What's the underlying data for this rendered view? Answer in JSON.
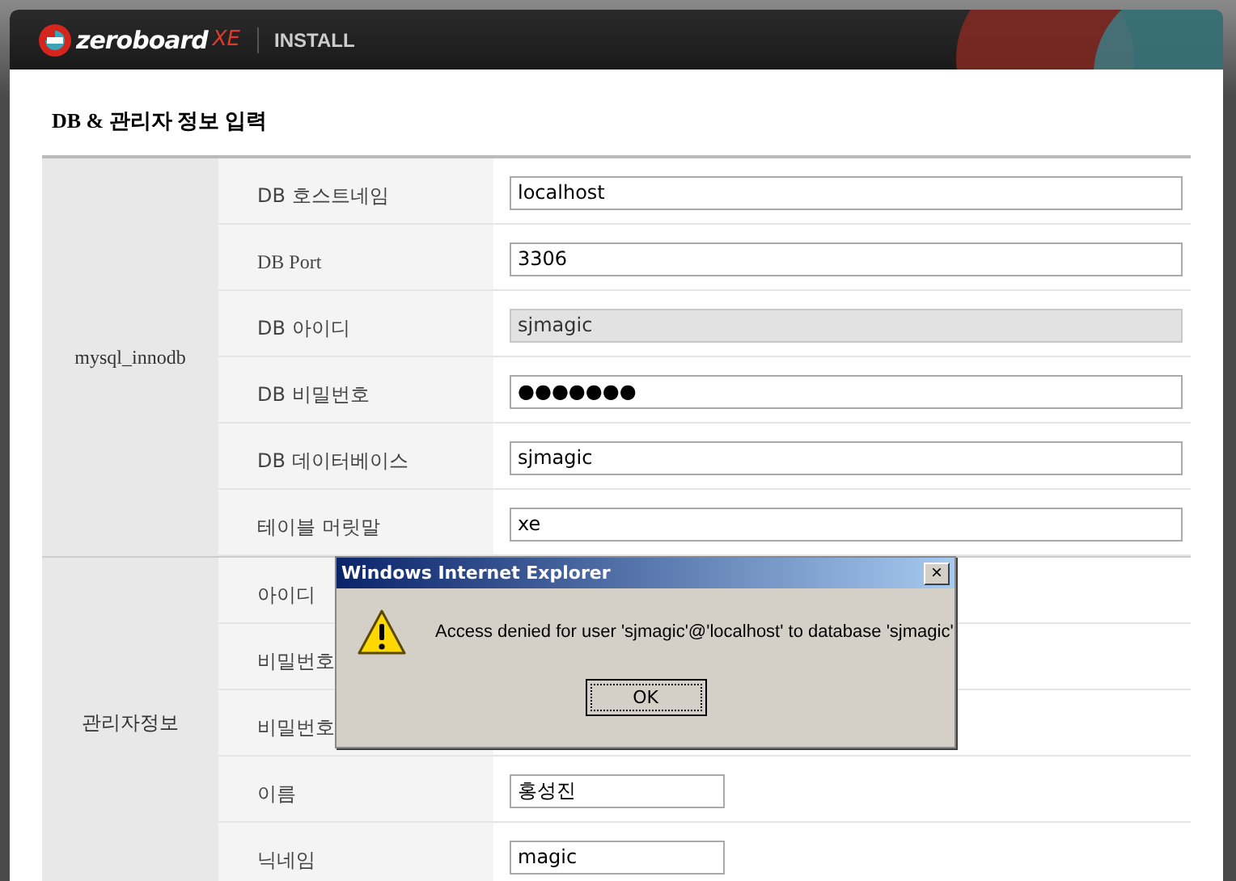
{
  "header": {
    "logo_text": "zeroboard",
    "logo_suffix": "XE",
    "section": "INSTALL"
  },
  "form": {
    "title": "DB & 관리자 정보 입력",
    "groups": [
      {
        "label": "mysql_innodb",
        "rows": [
          {
            "label": "DB 호스트네임",
            "value": "localhost",
            "readonly": false
          },
          {
            "label": "DB Port",
            "value": "3306",
            "readonly": false
          },
          {
            "label": "DB 아이디",
            "value": "sjmagic",
            "readonly": true
          },
          {
            "label": "DB 비밀번호",
            "value": "●●●●●●●",
            "readonly": false
          },
          {
            "label": "DB 데이터베이스",
            "value": "sjmagic",
            "readonly": false
          },
          {
            "label": "테이블 머릿말",
            "value": "xe",
            "readonly": false
          }
        ]
      },
      {
        "label": "관리자정보",
        "rows": [
          {
            "label": "아이디"
          },
          {
            "label": "비밀번호"
          },
          {
            "label": "비밀번호"
          },
          {
            "label": "이름",
            "value": "홍성진",
            "readonly": false
          },
          {
            "label": "닉네임",
            "value": "magic",
            "readonly": false
          }
        ]
      }
    ]
  },
  "dialog": {
    "title": "Windows Internet Explorer",
    "close": "×",
    "message": "Access denied for user 'sjmagic'@'localhost' to database 'sjmagic'",
    "button": "OK"
  }
}
